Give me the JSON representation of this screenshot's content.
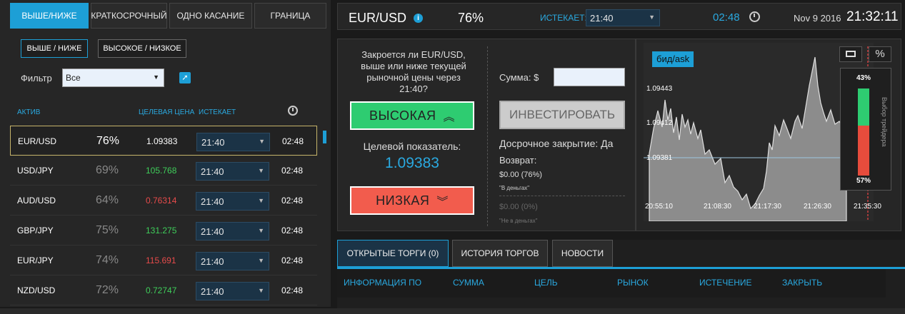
{
  "left": {
    "tabs": [
      "ВЫШЕ/НИЖЕ",
      "КРАТКОСРОЧНЫЙ",
      "ОДНО КАСАНИЕ",
      "ГРАНИЦА"
    ],
    "subtabs": [
      "ВЫШЕ / НИЖЕ",
      "ВЫСОКОЕ / НИЗКОЕ"
    ],
    "filter_label": "Фильтр",
    "filter_value": "Все",
    "columns": {
      "asset": "АКТИВ",
      "target": "ЦЕЛЕВАЯ ЦЕНА",
      "expires": "ИСТЕКАЕТ"
    },
    "rows": [
      {
        "asset": "EUR/USD",
        "pct": "76%",
        "price": "1.09383",
        "dir": "neu",
        "exp": "21:40",
        "time": "02:48"
      },
      {
        "asset": "USD/JPY",
        "pct": "69%",
        "price": "105.768",
        "dir": "up",
        "exp": "21:40",
        "time": "02:48"
      },
      {
        "asset": "AUD/USD",
        "pct": "64%",
        "price": "0.76314",
        "dir": "down",
        "exp": "21:40",
        "time": "02:48"
      },
      {
        "asset": "GBP/JPY",
        "pct": "75%",
        "price": "131.275",
        "dir": "up",
        "exp": "21:40",
        "time": "02:48"
      },
      {
        "asset": "EUR/JPY",
        "pct": "74%",
        "price": "115.691",
        "dir": "down",
        "exp": "21:40",
        "time": "02:48"
      },
      {
        "asset": "NZD/USD",
        "pct": "72%",
        "price": "0.72747",
        "dir": "up",
        "exp": "21:40",
        "time": "02:48"
      }
    ]
  },
  "top": {
    "pair": "EUR/USD",
    "pct": "76%",
    "expires_label": "ИСТЕКАЕТ:",
    "expires_value": "21:40",
    "countdown": "02:48",
    "date": "Nov 9 2016",
    "clock": "21:32:11"
  },
  "panel": {
    "question": "Закроется ли EUR/USD, выше или ниже текущей рыночной цены через 21:40?",
    "high_label": "ВЫСОКАЯ",
    "low_label": "НИЗКАЯ",
    "target_label": "Целевой показатель:",
    "target_value": "1.09383",
    "amount_label": "Сумма: $",
    "amount_value": "",
    "invest_label": "ИНВЕСТИРОВАТЬ",
    "early_close": "Досрочное закрытие: Да",
    "return_label": "Возврат:",
    "return_in": "$0.00 (76%)",
    "in_money": "\"В деньгах\"",
    "return_out": "$0.00 (0%)",
    "out_money": "\"Не в деньгах\""
  },
  "chart": {
    "bidask": "бид/ask",
    "pct_btn": "%",
    "y_labels": [
      "1.09443",
      "1.09412",
      "1.09381"
    ],
    "x_labels": [
      "20:55:10",
      "21:08:30",
      "21:17:30",
      "21:26:30",
      "21:35:30"
    ],
    "sentiment_title": "Выбор трейдера",
    "sentiment_up": "43%",
    "sentiment_down": "57%",
    "up_fraction": 0.43,
    "colors": {
      "up": "#2ecc71",
      "down": "#e74c3c"
    }
  },
  "bottom": {
    "tabs": [
      "ОТКРЫТЫЕ ТОРГИ (0)",
      "ИСТОРИЯ ТОРГОВ",
      "НОВОСТИ"
    ],
    "columns": [
      "ИНФОРМАЦИЯ ПО",
      "СУММА",
      "ЦЕЛЬ",
      "РЫНОК",
      "ИСТЕЧЕНИЕ",
      "ЗАКРЫТЬ"
    ]
  }
}
